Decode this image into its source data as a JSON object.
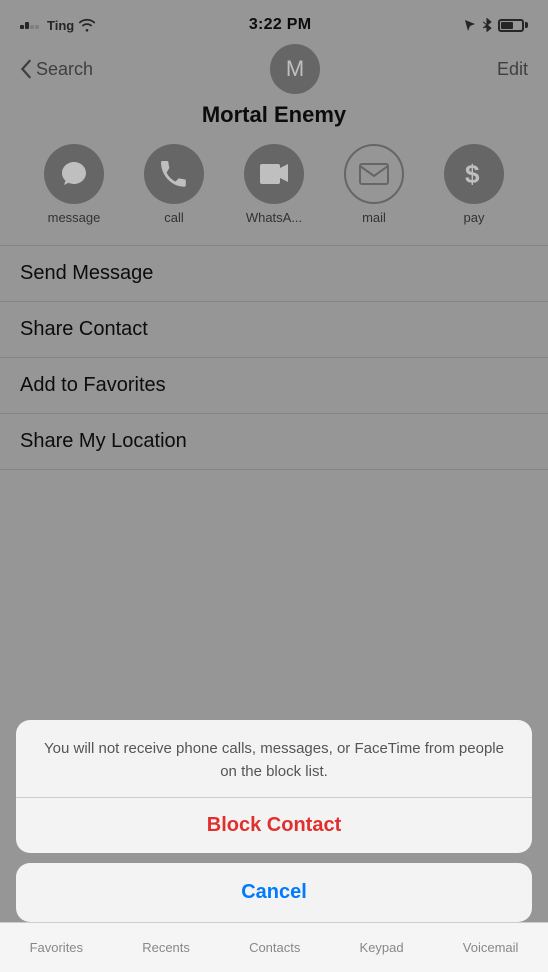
{
  "status_bar": {
    "carrier": "Ting",
    "time": "3:22 PM",
    "icons_right": [
      "location",
      "bluetooth",
      "battery"
    ]
  },
  "nav": {
    "back_label": "Search",
    "edit_label": "Edit",
    "avatar_letter": "M"
  },
  "contact": {
    "name": "Mortal Enemy"
  },
  "actions": [
    {
      "id": "message",
      "label": "message"
    },
    {
      "id": "call",
      "label": "call"
    },
    {
      "id": "whatsapp",
      "label": "WhatsA..."
    },
    {
      "id": "mail",
      "label": "mail"
    },
    {
      "id": "pay",
      "label": "pay"
    }
  ],
  "menu_items": [
    "Send Message",
    "Share Contact",
    "Add to Favorites",
    "Share My Location"
  ],
  "alert": {
    "message": "You will not receive phone calls, messages, or FaceTime from people on the block list.",
    "action_label": "Block Contact",
    "cancel_label": "Cancel"
  },
  "tab_bar": {
    "items": [
      "Favorites",
      "Recents",
      "Contacts",
      "Keypad",
      "Voicemail"
    ]
  }
}
